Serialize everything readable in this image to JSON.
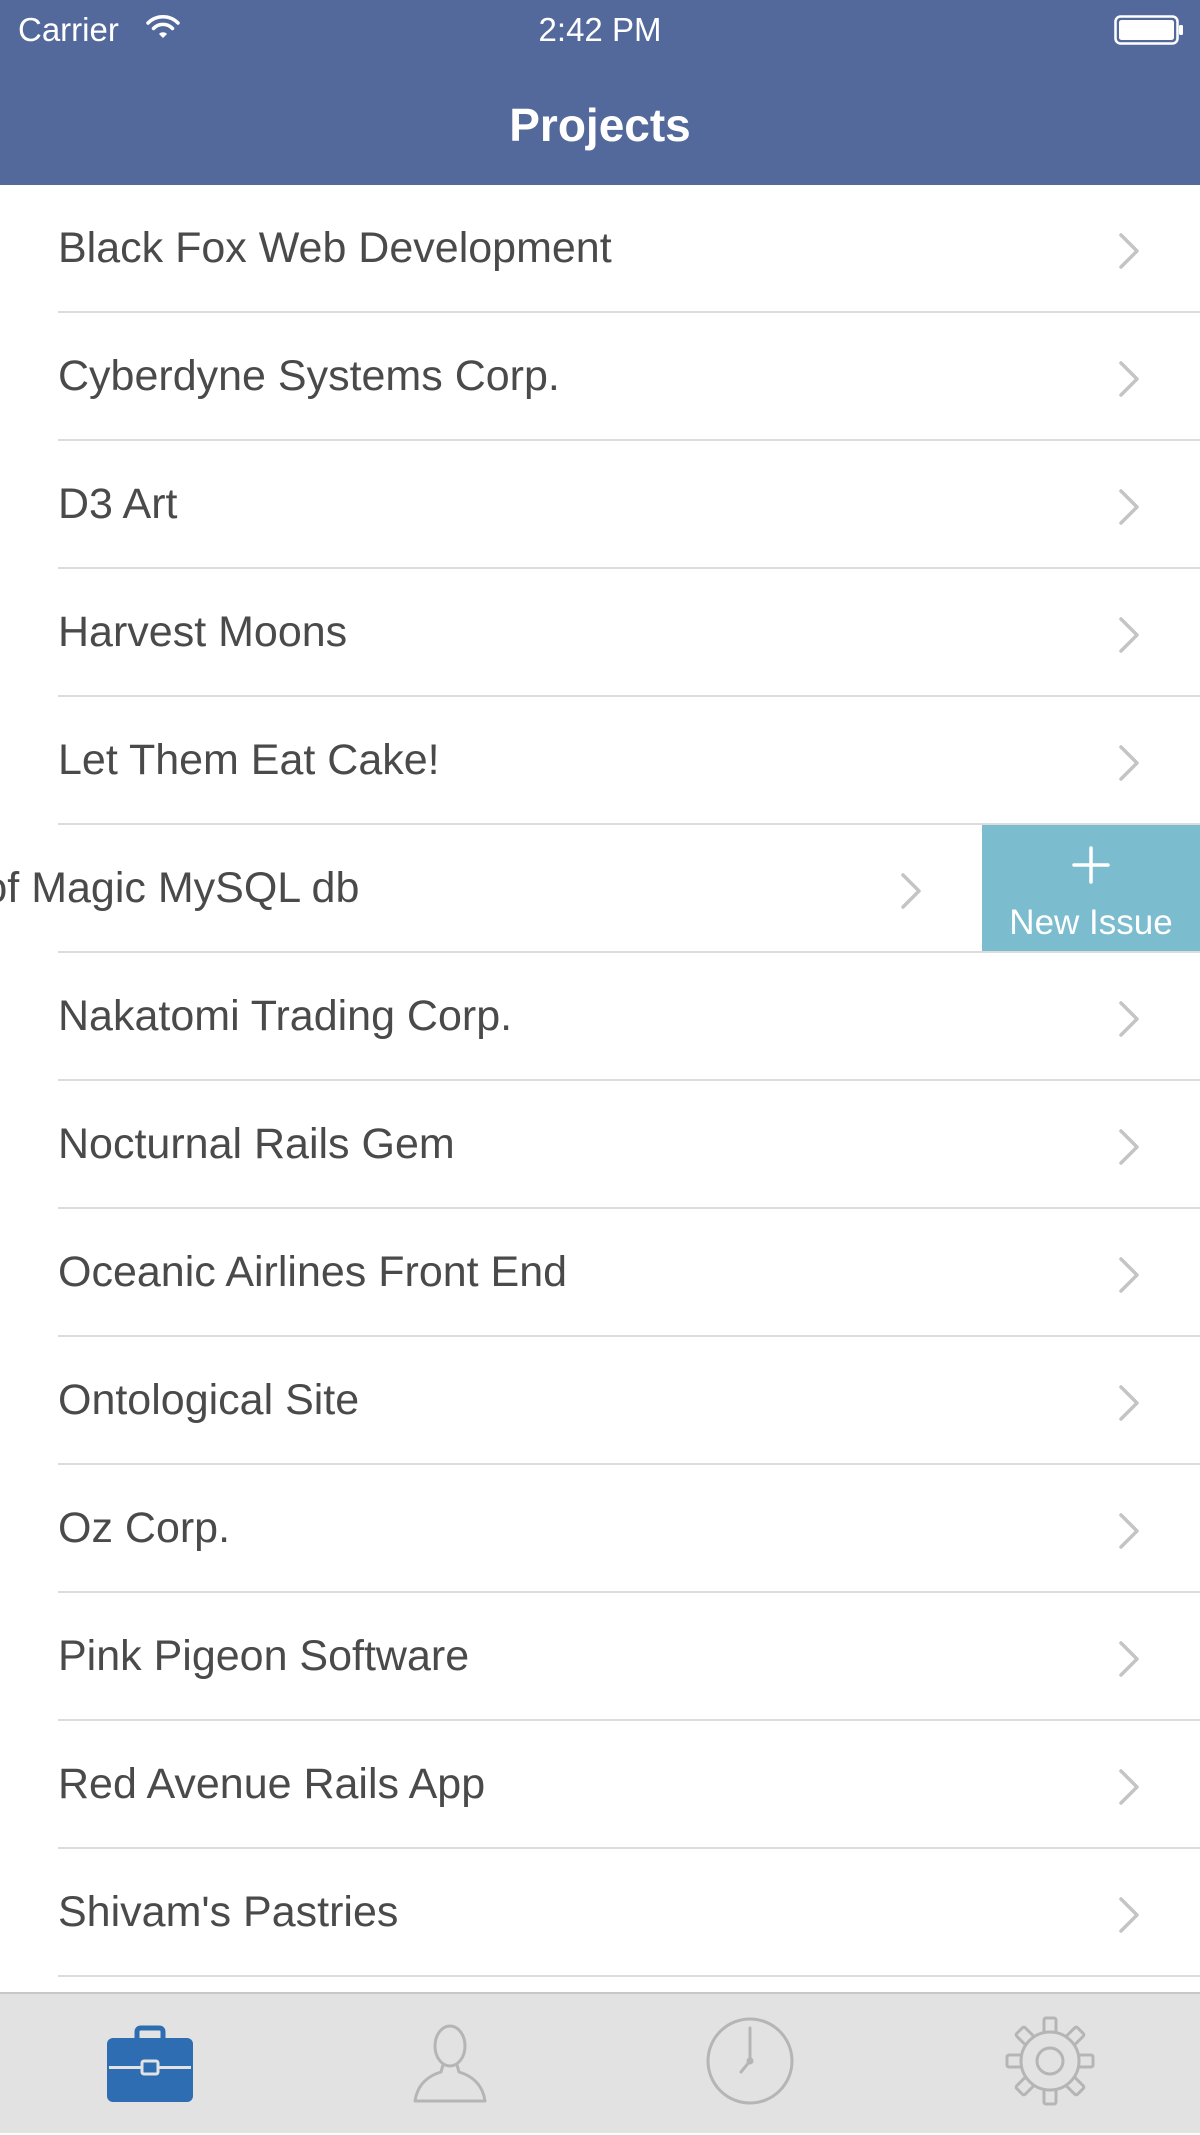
{
  "status_bar": {
    "carrier": "Carrier",
    "time": "2:42 PM"
  },
  "header": {
    "title": "Projects"
  },
  "colors": {
    "nav_bar": "#53699b",
    "action_button": "#7bbccf",
    "tab_active": "#2f6db3",
    "tab_inactive": "#b5b5b5"
  },
  "projects": [
    {
      "label": "Black Fox Web Development"
    },
    {
      "label": "Cyberdyne Systems Corp."
    },
    {
      "label": "D3 Art"
    },
    {
      "label": "Harvest Moons"
    },
    {
      "label": "Let Them Eat Cake!"
    },
    {
      "label": "Library of Magic MySQL db",
      "swiped": true
    },
    {
      "label": "Nakatomi Trading Corp."
    },
    {
      "label": "Nocturnal Rails Gem"
    },
    {
      "label": "Oceanic Airlines Front End"
    },
    {
      "label": "Ontological Site"
    },
    {
      "label": "Oz Corp."
    },
    {
      "label": "Pink Pigeon Software"
    },
    {
      "label": "Red Avenue Rails App"
    },
    {
      "label": "Shivam's Pastries"
    }
  ],
  "swipe_action": {
    "label": "New Issue",
    "icon": "plus-icon"
  },
  "tabs": [
    {
      "icon": "briefcase-icon",
      "active": true
    },
    {
      "icon": "person-icon",
      "active": false
    },
    {
      "icon": "clock-icon",
      "active": false
    },
    {
      "icon": "gear-icon",
      "active": false
    }
  ]
}
